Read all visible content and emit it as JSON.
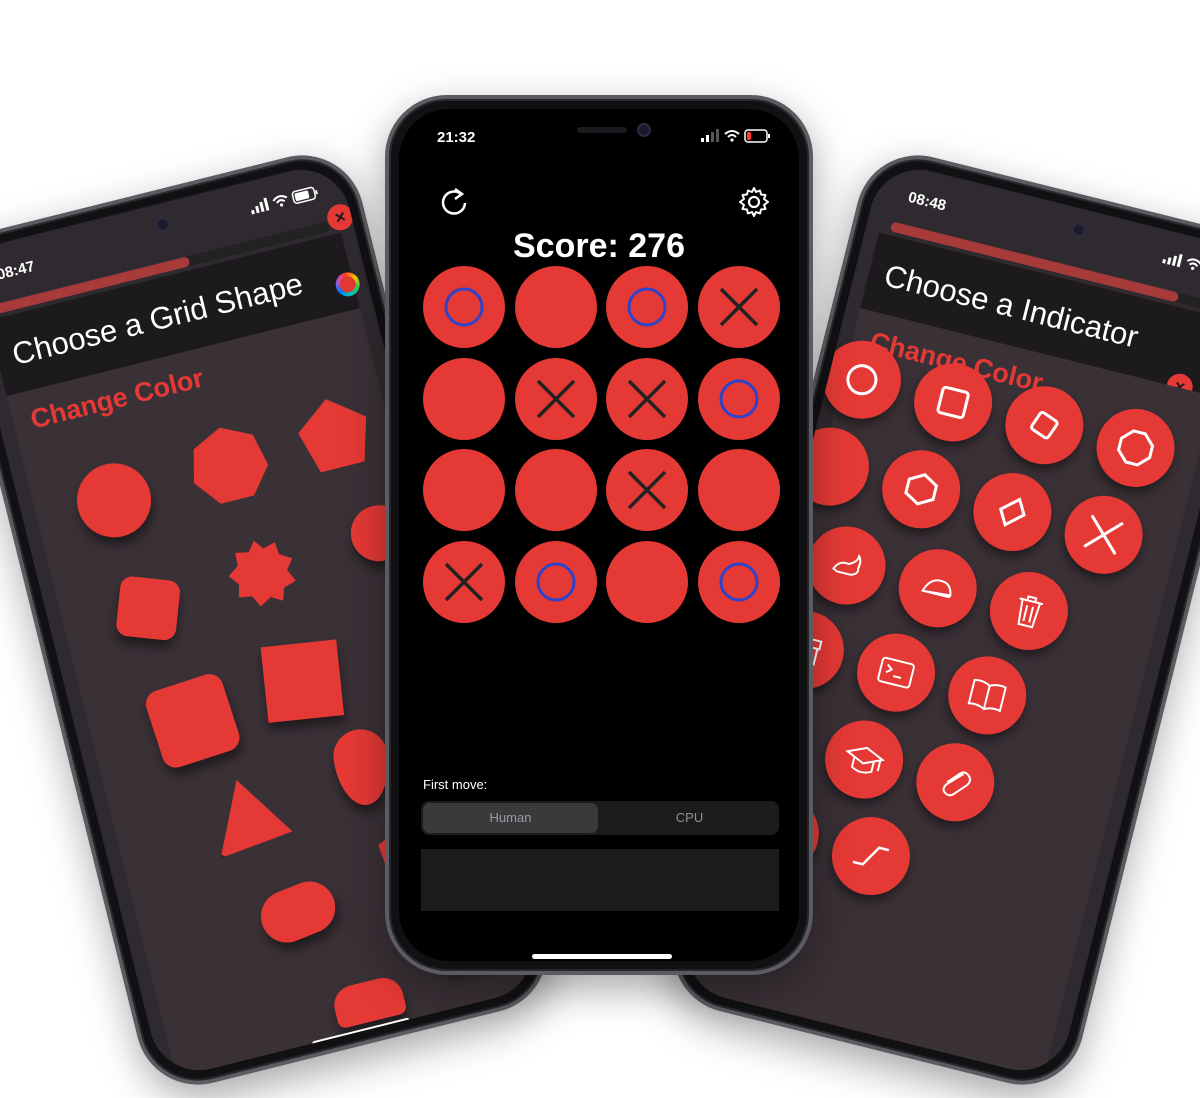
{
  "colors": {
    "accent": "#e53935",
    "sheet_bg": "#3a3137",
    "o_mark": "#2f43c8",
    "x_mark": "#222222"
  },
  "left_phone": {
    "time": "08:47",
    "title": "Choose a Grid Shape",
    "change_color": "Change Color",
    "close_icon": "close-icon",
    "shapes": [
      "circle",
      "heptagon",
      "pentagon",
      "rounded-diamond",
      "scalloped-badge",
      "heart-partial",
      "rounded-square",
      "tilted-square",
      "triangle-rounded",
      "teardrop",
      "pill",
      "pentagon-large",
      "cloud",
      "speech-bubble"
    ]
  },
  "center_phone": {
    "time": "21:32",
    "restart_icon": "restart-icon",
    "settings_icon": "gear-icon",
    "score_text": "Score: 276",
    "board": [
      [
        "O",
        "",
        "O",
        "X"
      ],
      [
        "",
        "X",
        "X",
        "O"
      ],
      [
        "",
        "",
        "X",
        ""
      ],
      [
        "X",
        "O",
        "",
        "O"
      ]
    ],
    "first_move_label": "First move:",
    "first_move_options": [
      "Human",
      "CPU"
    ],
    "first_move_selected": "Human"
  },
  "right_phone": {
    "time": "08:48",
    "title": "Choose a Indicator",
    "change_color": "Change Color",
    "indicators": [
      "circle",
      "square",
      "diamond-square",
      "octagon",
      "hexagon",
      "rhombus",
      "xmark",
      "hare",
      "tortoise",
      "trash",
      "archivebox",
      "terminal",
      "book",
      "graduationcap",
      "paperclip",
      "option-key",
      "control-key"
    ]
  }
}
